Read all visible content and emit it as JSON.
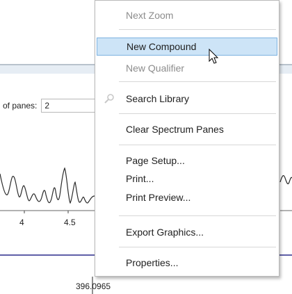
{
  "background": {
    "panes_label": "of panes:",
    "panes_value": "2",
    "axis_ticks": [
      "4",
      "4.5"
    ],
    "peak_label": "396.0965"
  },
  "context_menu": {
    "items": [
      {
        "label": "Next Zoom",
        "disabled": true
      },
      {
        "label": "New Compound",
        "disabled": false,
        "hovered": true
      },
      {
        "label": "New Qualifier",
        "disabled": true
      },
      {
        "label": "Search Library",
        "disabled": false,
        "icon": "search-library-icon"
      },
      {
        "label": "Clear Spectrum Panes",
        "disabled": false
      },
      {
        "label": "Page Setup...",
        "disabled": false
      },
      {
        "label": "Print...",
        "disabled": false
      },
      {
        "label": "Print Preview...",
        "disabled": false
      },
      {
        "label": "Export Graphics...",
        "disabled": false
      },
      {
        "label": "Properties...",
        "disabled": false
      }
    ]
  },
  "colors": {
    "hover_fill": "#cde4f7",
    "hover_border": "#7cb2e0",
    "disabled_text": "#8c8c8c",
    "axis_line": "#2a2a8a"
  }
}
